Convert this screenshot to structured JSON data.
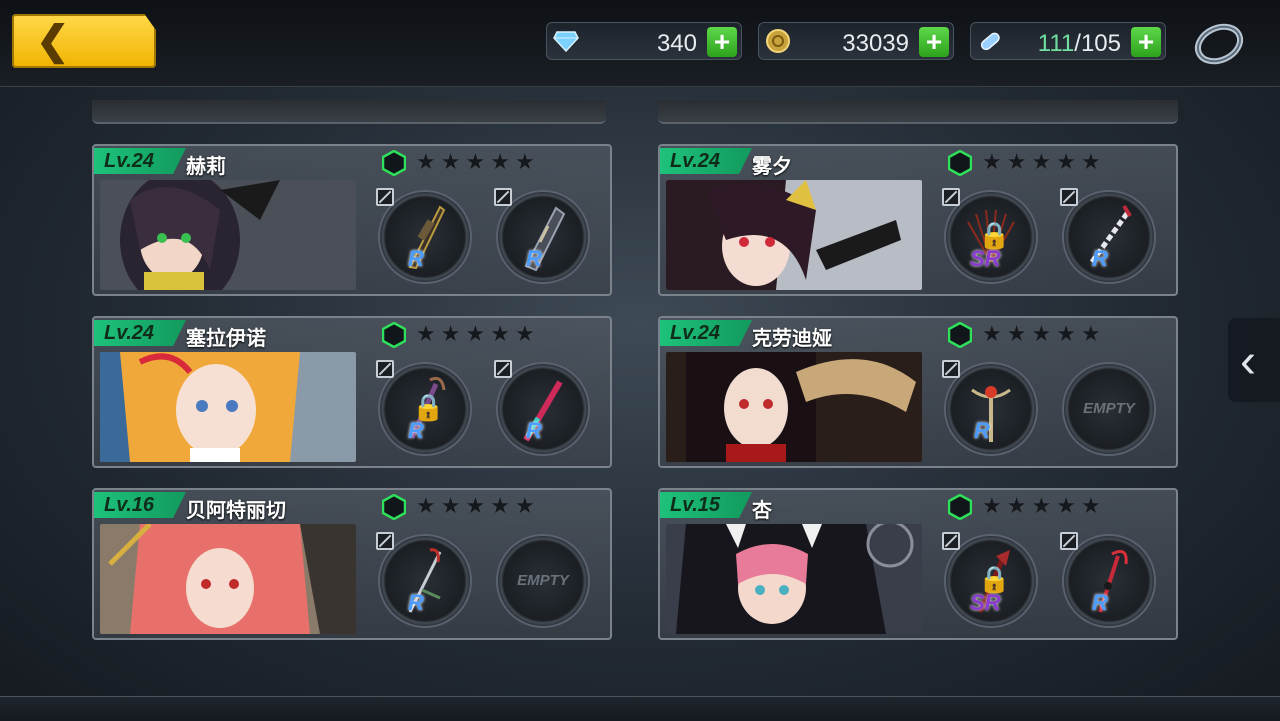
{
  "header": {
    "resources": {
      "gems": "340",
      "gold": "33039",
      "stamina_current": "111",
      "stamina_max": "/105"
    }
  },
  "cards": [
    {
      "level": "Lv.24",
      "name": "赫莉",
      "slots": [
        {
          "rank": "R",
          "locked": false
        },
        {
          "rank": "R",
          "locked": false
        }
      ]
    },
    {
      "level": "Lv.24",
      "name": "雾夕",
      "slots": [
        {
          "rank": "SR",
          "locked": true
        },
        {
          "rank": "R",
          "locked": false
        }
      ]
    },
    {
      "level": "Lv.24",
      "name": "塞拉伊诺",
      "slots": [
        {
          "rank": "R",
          "locked": true
        },
        {
          "rank": "R",
          "locked": false
        }
      ]
    },
    {
      "level": "Lv.24",
      "name": "克劳迪娅",
      "slots": [
        {
          "rank": "R",
          "locked": false
        },
        {
          "empty": "EMPTY"
        }
      ]
    },
    {
      "level": "Lv.16",
      "name": "贝阿特丽切",
      "slots": [
        {
          "rank": "R",
          "locked": false
        },
        {
          "empty": "EMPTY"
        }
      ]
    },
    {
      "level": "Lv.15",
      "name": "杏",
      "slots": [
        {
          "rank": "SR",
          "locked": true
        },
        {
          "rank": "R",
          "locked": false
        }
      ]
    }
  ],
  "colors": {
    "level_badge": "#1ec27a",
    "plus_button": "#3ec22a",
    "back_button": "#f5c518",
    "rank_r": "#4a9cff",
    "rank_sr": "#8a3ad0"
  },
  "icons": {
    "back": "chevron-left-icon",
    "gem": "diamond-icon",
    "gold": "coin-icon",
    "stamina": "capsule-icon",
    "settings": "ring-icon",
    "page_next": "chevron-left-icon"
  }
}
